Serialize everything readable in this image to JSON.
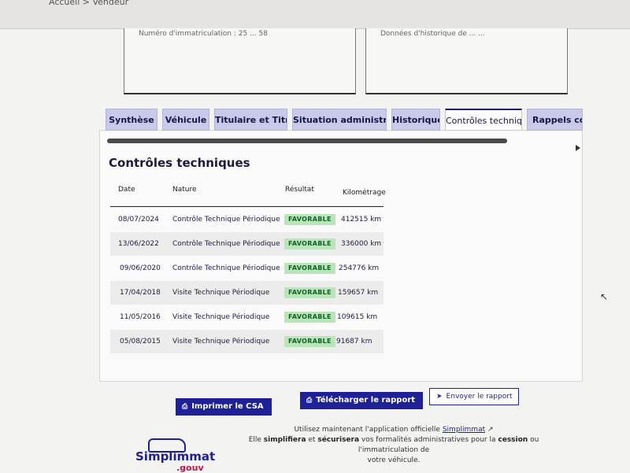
{
  "header": {
    "breadcrumb_partial": "Accueil > Vendeur"
  },
  "upper": {
    "left_text": "Numéro d'immatriculation : 25 ... 58",
    "right_text": "Données d'historique de ... ..."
  },
  "tabs": [
    {
      "label": "Synthèse"
    },
    {
      "label": "Véhicule"
    },
    {
      "label": "Titulaire et Titre"
    },
    {
      "label": "Situation administrative"
    },
    {
      "label": "Historique"
    },
    {
      "label": "Contrôles techniques",
      "active": true
    },
    {
      "label": "Rappels constructeur"
    }
  ],
  "section": {
    "title": "Contrôles techniques"
  },
  "table": {
    "headers": {
      "date": "Date",
      "nature": "Nature",
      "result": "Résultat",
      "mileage": "Kilométrage"
    },
    "rows": [
      {
        "date": "08/07/2024",
        "nature": "Contrôle Technique Périodique",
        "result": "FAVORABLE",
        "mileage": "412515 km"
      },
      {
        "date": "13/06/2022",
        "nature": "Contrôle Technique Périodique",
        "result": "FAVORABLE",
        "mileage": "336000 km"
      },
      {
        "date": "09/06/2020",
        "nature": "Contrôle Technique Périodique",
        "result": "FAVORABLE",
        "mileage": "254776 km"
      },
      {
        "date": "17/04/2018",
        "nature": "Visite Technique Périodique",
        "result": "FAVORABLE",
        "mileage": "159657 km"
      },
      {
        "date": "11/05/2016",
        "nature": "Visite Technique Périodique",
        "result": "FAVORABLE",
        "mileage": "109615 km"
      },
      {
        "date": "05/08/2015",
        "nature": "Visite Technique Périodique",
        "result": "FAVORABLE",
        "mileage": "91687 km"
      }
    ]
  },
  "actions": {
    "print_label": "Imprimer le CSA",
    "download_label": "Télécharger le rapport",
    "send_label": "Envoyer le rapport"
  },
  "promo": {
    "line1_prefix": "Utilisez maintenant l'application officielle",
    "link": "Simplimmat",
    "line2_a": "Elle",
    "line2_b": "simplifiera",
    "line2_c": "et",
    "line2_d": "sécurisera",
    "line2_e": "vos formalités administratives pour la",
    "line2_f": "cession",
    "line2_g": "ou l'immatriculation de",
    "line3": "votre véhicule."
  },
  "logo": {
    "name": "Simplimmat",
    "suffix": ".gouv"
  },
  "colors": {
    "primary": "#1f1f96",
    "tab_bg": "#c9c9ea",
    "favorable_bg": "#b8e6b8",
    "favorable_fg": "#14602a"
  },
  "icons": {
    "print": "printer-icon",
    "download": "download-icon",
    "send": "send-icon",
    "external": "external-link-icon"
  }
}
